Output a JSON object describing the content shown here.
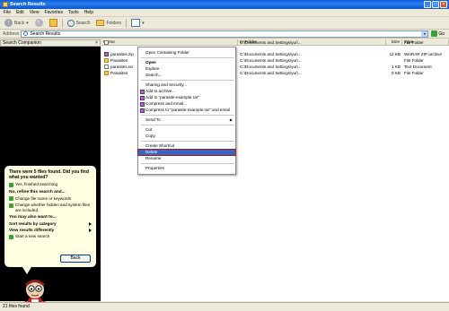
{
  "window": {
    "title": "Search Results"
  },
  "menu": [
    "File",
    "Edit",
    "View",
    "Favorites",
    "Tools",
    "Help"
  ],
  "toolbar": {
    "back_label": "Back",
    "search_label": "Search",
    "folders_label": "Folders"
  },
  "address": {
    "label": "Address",
    "value": "Search Results",
    "go_label": "Go"
  },
  "side_pane": {
    "title": "Search Companion",
    "close_glyph": "×",
    "question": "There were 5 files found. Did you find what you wanted?",
    "yes_label": "Yes, finished searching",
    "refine_heading": "No, refine this search and...",
    "refine_options": [
      "Change file name or keywords",
      "Change whether hidden and system files are included"
    ],
    "also_heading": "You may also want to...",
    "sort_label": "Sort results by category",
    "view_label": "View results differently",
    "new_search_label": "Start a new search",
    "back_button": "Back"
  },
  "columns": {
    "name": "Name",
    "in_folder": "In Folder",
    "size": "Size",
    "type": "Type"
  },
  "files": [
    {
      "name": "parasite-example",
      "folder": "C:\\Documents and Settings\\yur\\...",
      "size": "",
      "type": "File Folder",
      "icon": "file",
      "selected": true
    },
    {
      "name": "parasites.zip",
      "folder": "C:\\Documents and Settings\\yur\\...",
      "size": "12 KB",
      "type": "WinRAR ZIP archive",
      "icon": "zip",
      "selected": false
    },
    {
      "name": "Parasites",
      "folder": "C:\\Documents and Settings\\yur\\...",
      "size": "",
      "type": "File Folder",
      "icon": "folder",
      "selected": false
    },
    {
      "name": "parasites.txt",
      "folder": "C:\\Documents and Settings\\yur\\...",
      "size": "1 KB",
      "type": "Text Document",
      "icon": "file",
      "selected": false
    },
    {
      "name": "Parasites",
      "folder": "C:\\Documents and Settings\\yur\\...",
      "size": "0 KB",
      "type": "File Folder",
      "icon": "folder",
      "selected": false
    }
  ],
  "context_menu": {
    "open_containing_folder": "Open Containing Folder",
    "open": "Open",
    "explore": "Explore",
    "search": "Search...",
    "sharing": "Sharing and Security...",
    "add_archive": "Add to archive...",
    "add_named": "Add to \"parasite-example.rar\"",
    "compress_email": "Compress and email...",
    "compress_named_email": "Compress to \"parasite-example.rar\" and email",
    "send_to": "Send To",
    "cut": "Cut",
    "copy": "Copy",
    "create_shortcut": "Create Shortcut",
    "delete": "Delete",
    "rename": "Rename",
    "properties": "Properties"
  },
  "status": {
    "text": "21 files found"
  },
  "colors": {
    "titlebar": "#0a5fd8",
    "selection": "#316ac5",
    "highlight_outline": "#b01818",
    "sidepane_bg": "#000000",
    "balloon_bg": "#ffffe1"
  }
}
